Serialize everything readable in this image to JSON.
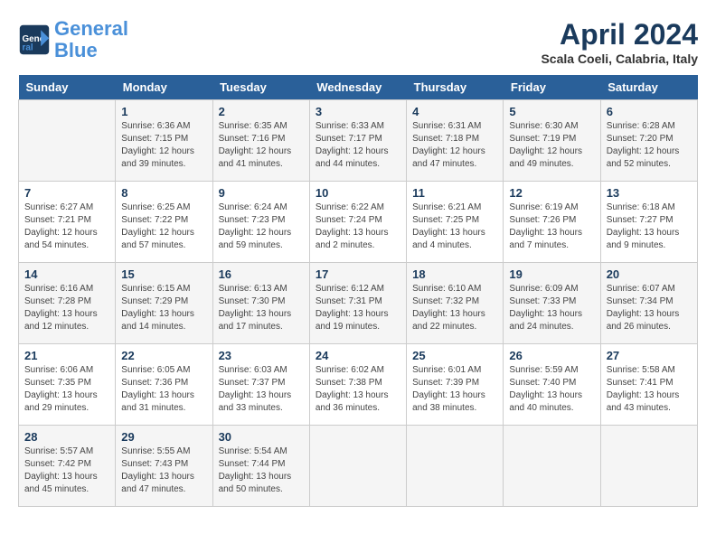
{
  "header": {
    "logo_line1": "General",
    "logo_line2": "Blue",
    "month": "April 2024",
    "location": "Scala Coeli, Calabria, Italy"
  },
  "days_of_week": [
    "Sunday",
    "Monday",
    "Tuesday",
    "Wednesday",
    "Thursday",
    "Friday",
    "Saturday"
  ],
  "weeks": [
    [
      {
        "day": "",
        "info": ""
      },
      {
        "day": "1",
        "info": "Sunrise: 6:36 AM\nSunset: 7:15 PM\nDaylight: 12 hours\nand 39 minutes."
      },
      {
        "day": "2",
        "info": "Sunrise: 6:35 AM\nSunset: 7:16 PM\nDaylight: 12 hours\nand 41 minutes."
      },
      {
        "day": "3",
        "info": "Sunrise: 6:33 AM\nSunset: 7:17 PM\nDaylight: 12 hours\nand 44 minutes."
      },
      {
        "day": "4",
        "info": "Sunrise: 6:31 AM\nSunset: 7:18 PM\nDaylight: 12 hours\nand 47 minutes."
      },
      {
        "day": "5",
        "info": "Sunrise: 6:30 AM\nSunset: 7:19 PM\nDaylight: 12 hours\nand 49 minutes."
      },
      {
        "day": "6",
        "info": "Sunrise: 6:28 AM\nSunset: 7:20 PM\nDaylight: 12 hours\nand 52 minutes."
      }
    ],
    [
      {
        "day": "7",
        "info": "Sunrise: 6:27 AM\nSunset: 7:21 PM\nDaylight: 12 hours\nand 54 minutes."
      },
      {
        "day": "8",
        "info": "Sunrise: 6:25 AM\nSunset: 7:22 PM\nDaylight: 12 hours\nand 57 minutes."
      },
      {
        "day": "9",
        "info": "Sunrise: 6:24 AM\nSunset: 7:23 PM\nDaylight: 12 hours\nand 59 minutes."
      },
      {
        "day": "10",
        "info": "Sunrise: 6:22 AM\nSunset: 7:24 PM\nDaylight: 13 hours\nand 2 minutes."
      },
      {
        "day": "11",
        "info": "Sunrise: 6:21 AM\nSunset: 7:25 PM\nDaylight: 13 hours\nand 4 minutes."
      },
      {
        "day": "12",
        "info": "Sunrise: 6:19 AM\nSunset: 7:26 PM\nDaylight: 13 hours\nand 7 minutes."
      },
      {
        "day": "13",
        "info": "Sunrise: 6:18 AM\nSunset: 7:27 PM\nDaylight: 13 hours\nand 9 minutes."
      }
    ],
    [
      {
        "day": "14",
        "info": "Sunrise: 6:16 AM\nSunset: 7:28 PM\nDaylight: 13 hours\nand 12 minutes."
      },
      {
        "day": "15",
        "info": "Sunrise: 6:15 AM\nSunset: 7:29 PM\nDaylight: 13 hours\nand 14 minutes."
      },
      {
        "day": "16",
        "info": "Sunrise: 6:13 AM\nSunset: 7:30 PM\nDaylight: 13 hours\nand 17 minutes."
      },
      {
        "day": "17",
        "info": "Sunrise: 6:12 AM\nSunset: 7:31 PM\nDaylight: 13 hours\nand 19 minutes."
      },
      {
        "day": "18",
        "info": "Sunrise: 6:10 AM\nSunset: 7:32 PM\nDaylight: 13 hours\nand 22 minutes."
      },
      {
        "day": "19",
        "info": "Sunrise: 6:09 AM\nSunset: 7:33 PM\nDaylight: 13 hours\nand 24 minutes."
      },
      {
        "day": "20",
        "info": "Sunrise: 6:07 AM\nSunset: 7:34 PM\nDaylight: 13 hours\nand 26 minutes."
      }
    ],
    [
      {
        "day": "21",
        "info": "Sunrise: 6:06 AM\nSunset: 7:35 PM\nDaylight: 13 hours\nand 29 minutes."
      },
      {
        "day": "22",
        "info": "Sunrise: 6:05 AM\nSunset: 7:36 PM\nDaylight: 13 hours\nand 31 minutes."
      },
      {
        "day": "23",
        "info": "Sunrise: 6:03 AM\nSunset: 7:37 PM\nDaylight: 13 hours\nand 33 minutes."
      },
      {
        "day": "24",
        "info": "Sunrise: 6:02 AM\nSunset: 7:38 PM\nDaylight: 13 hours\nand 36 minutes."
      },
      {
        "day": "25",
        "info": "Sunrise: 6:01 AM\nSunset: 7:39 PM\nDaylight: 13 hours\nand 38 minutes."
      },
      {
        "day": "26",
        "info": "Sunrise: 5:59 AM\nSunset: 7:40 PM\nDaylight: 13 hours\nand 40 minutes."
      },
      {
        "day": "27",
        "info": "Sunrise: 5:58 AM\nSunset: 7:41 PM\nDaylight: 13 hours\nand 43 minutes."
      }
    ],
    [
      {
        "day": "28",
        "info": "Sunrise: 5:57 AM\nSunset: 7:42 PM\nDaylight: 13 hours\nand 45 minutes."
      },
      {
        "day": "29",
        "info": "Sunrise: 5:55 AM\nSunset: 7:43 PM\nDaylight: 13 hours\nand 47 minutes."
      },
      {
        "day": "30",
        "info": "Sunrise: 5:54 AM\nSunset: 7:44 PM\nDaylight: 13 hours\nand 50 minutes."
      },
      {
        "day": "",
        "info": ""
      },
      {
        "day": "",
        "info": ""
      },
      {
        "day": "",
        "info": ""
      },
      {
        "day": "",
        "info": ""
      }
    ]
  ]
}
